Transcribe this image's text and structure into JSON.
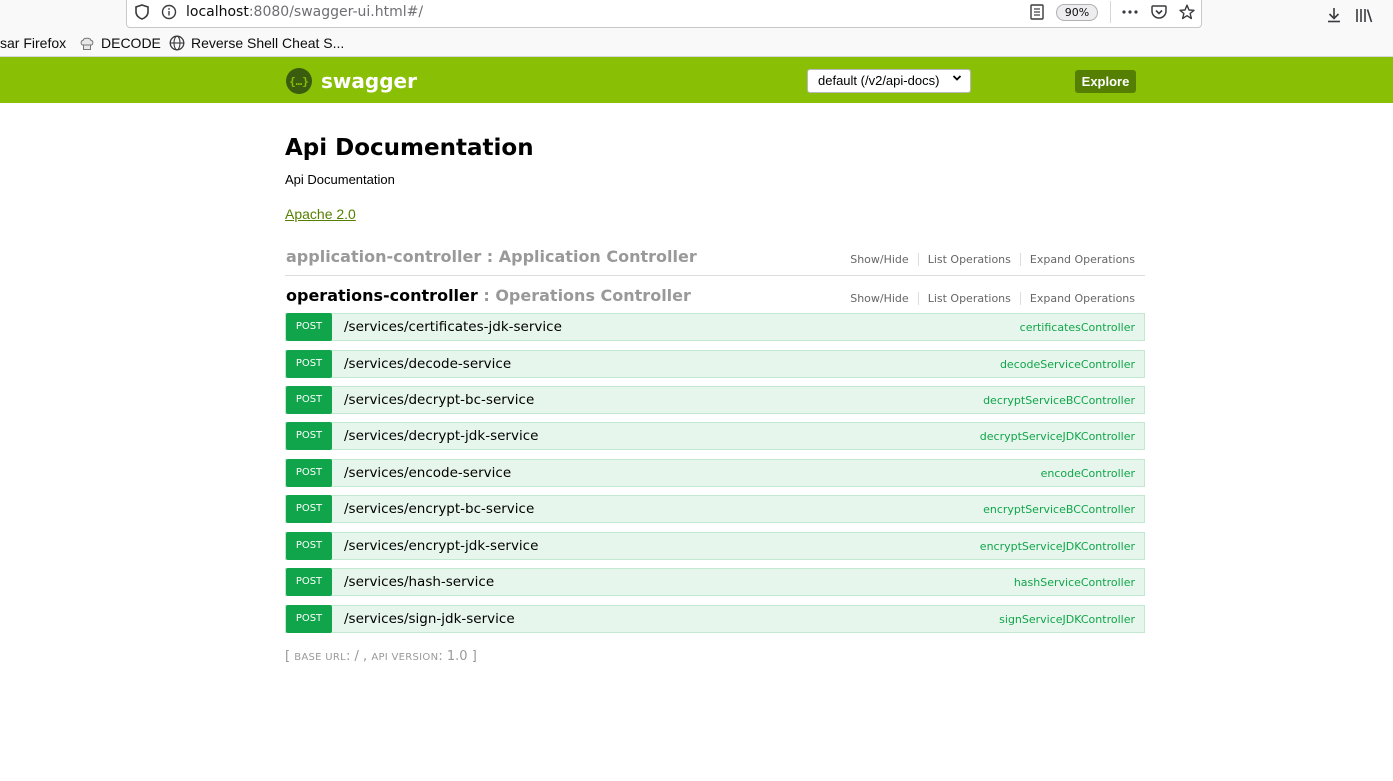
{
  "browser": {
    "url_host": "localhost",
    "url_rest": ":8080/swagger-ui.html#/",
    "zoom": "90%",
    "bookmarks": [
      {
        "label": "sar Firefox",
        "icon": "none"
      },
      {
        "label": "DECODE",
        "icon": "chef-hat-icon"
      },
      {
        "label": "Reverse Shell Cheat S...",
        "icon": "globe-icon"
      }
    ]
  },
  "header": {
    "logo_text": "swagger",
    "logo_mark": "{…}",
    "spec_select": "default (/v2/api-docs)",
    "explore_label": "Explore"
  },
  "info": {
    "title": "Api Documentation",
    "description": "Api Documentation",
    "license": "Apache 2.0"
  },
  "resources": [
    {
      "name": "application-controller",
      "description": ": Application Controller",
      "show_hide": "Show/Hide",
      "list_ops": "List Operations",
      "expand_ops": "Expand Operations"
    },
    {
      "name": "operations-controller",
      "description": ": Operations Controller",
      "show_hide": "Show/Hide",
      "list_ops": "List Operations",
      "expand_ops": "Expand Operations"
    }
  ],
  "operations": [
    {
      "method": "POST",
      "path": "/services/certificates-jdk-service",
      "nickname": "certificatesController"
    },
    {
      "method": "POST",
      "path": "/services/decode-service",
      "nickname": "decodeServiceController"
    },
    {
      "method": "POST",
      "path": "/services/decrypt-bc-service",
      "nickname": "decryptServiceBCController"
    },
    {
      "method": "POST",
      "path": "/services/decrypt-jdk-service",
      "nickname": "decryptServiceJDKController"
    },
    {
      "method": "POST",
      "path": "/services/encode-service",
      "nickname": "encodeController"
    },
    {
      "method": "POST",
      "path": "/services/encrypt-bc-service",
      "nickname": "encryptServiceBCController"
    },
    {
      "method": "POST",
      "path": "/services/encrypt-jdk-service",
      "nickname": "encryptServiceJDKController"
    },
    {
      "method": "POST",
      "path": "/services/hash-service",
      "nickname": "hashServiceController"
    },
    {
      "method": "POST",
      "path": "/services/sign-jdk-service",
      "nickname": "signServiceJDKController"
    }
  ],
  "footer": {
    "open_bracket": "[",
    "base_url_label": "BASE URL",
    "base_url_value": ": / ,",
    "api_version_label": "API VERSION",
    "api_version_value": ": 1.0 ]"
  },
  "colors": {
    "header_green": "#89bf04",
    "explore_green": "#547f00",
    "post_green": "#10a54a",
    "post_row_bg": "#e7f6ec"
  }
}
